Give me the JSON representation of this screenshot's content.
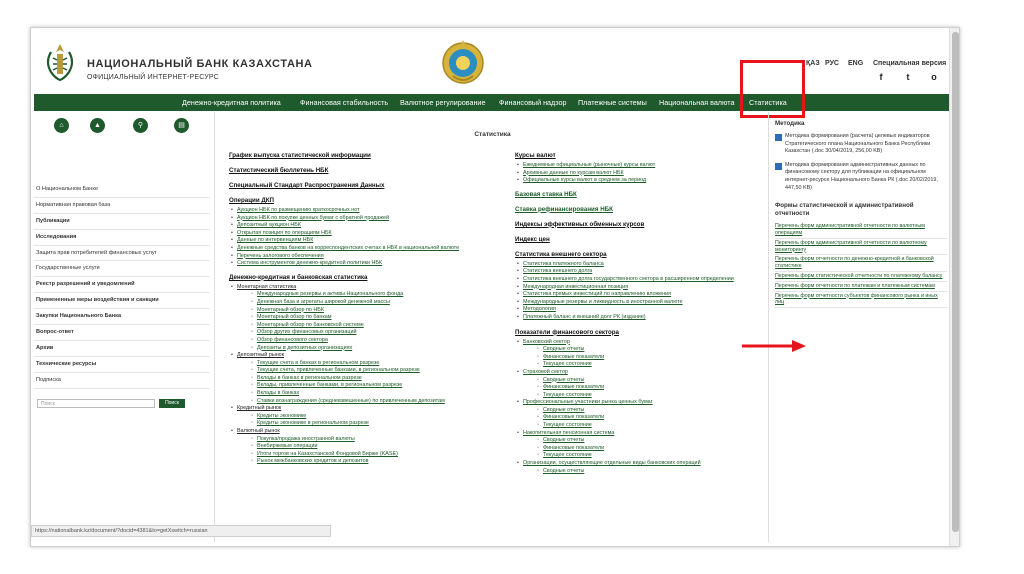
{
  "header": {
    "bank_name": "НАЦИОНАЛЬНЫЙ БАНК КАЗАХСТАНА",
    "bank_sub": "ОФИЦИАЛЬНЫЙ ИНТЕРНЕТ-РЕСУРС",
    "lang_kz": "ҚАЗ",
    "lang_ru": "РУС",
    "lang_en": "ENG",
    "special_version": "Специальная версия",
    "social": {
      "facebook": "f",
      "twitter": "t",
      "instagram": "o"
    }
  },
  "nav": {
    "items": [
      "Денежно-кредитная политика",
      "Финансовая стабильность",
      "Валютное регулирование",
      "Финансовый надзор",
      "Платежные системы",
      "Национальная валюта",
      "Статистика"
    ]
  },
  "sidebar": {
    "icons": [
      "home-icon",
      "user-icon",
      "search-icon",
      "printer-icon"
    ],
    "items": [
      "О Национальном Банке",
      "Нормативная правовая база",
      "Публикации",
      "Исследования",
      "Защита прав потребителей финансовых услуг",
      "Государственные услуги",
      "Реестр разрешений и уведомлений",
      "Примененные меры воздействия и санкции",
      "Закупки Национального Банка",
      "Вопрос-ответ",
      "Архив",
      "Технические ресурсы",
      "Подписка"
    ],
    "search_placeholder": "Поиск",
    "search_button": "Поиск"
  },
  "main": {
    "title": "Статистика",
    "left": {
      "s1": "График выпуска статистической информации",
      "s2": "Статистический бюллетень НБК",
      "s3": "Специальный Стандарт Распространения Данных",
      "s4": "Операции ДКП",
      "ops": [
        "Аукцион НБК по размещению краткосрочных нот",
        "Аукцион НБК по покупке ценных бумаг с обратной продажей",
        "Депозитный аукцион НБК",
        "Открытая позиция по операциям НБК",
        "Данные по интервенциям НБК",
        "Денежные средства банков на корреспондентских счетах в НБК в национальной валюте",
        "Перечень залогового обеспечения",
        "Система инструментов денежно-кредитной политики НБК"
      ],
      "s5": "Денежно-кредитная и банковская статистика",
      "dk": [
        {
          "t": "Монетарная статистика",
          "l": 1
        },
        {
          "t": "Международные резервы и активы Национального фонда",
          "l": 2
        },
        {
          "t": "Денежная база и агрегаты широкой денежной массы",
          "l": 2
        },
        {
          "t": "Монетарный обзор по НБК",
          "l": 2
        },
        {
          "t": "Монетарный обзор по банкам",
          "l": 2
        },
        {
          "t": "Монетарный обзор по банковской системе",
          "l": 2
        },
        {
          "t": "Обзор других финансовых организаций",
          "l": 2
        },
        {
          "t": "Обзор финансового сектора",
          "l": 2
        },
        {
          "t": "Депозиты в депозитных организациях",
          "l": 2
        },
        {
          "t": "Депозитный рынок",
          "l": 1
        },
        {
          "t": "Текущие счета в банках в региональном разрезе",
          "l": 2
        },
        {
          "t": "Текущие счета, привлеченные банками, в региональном разрезе",
          "l": 2
        },
        {
          "t": "Вклады в банках в региональном разрезе",
          "l": 2
        },
        {
          "t": "Вклады, привлеченные банками, в региональном разрезе",
          "l": 2
        },
        {
          "t": "Вклады в банках",
          "l": 2
        },
        {
          "t": "Ставки вознаграждения (средневзвешенные) по привлеченным депозитам",
          "l": 2
        },
        {
          "t": "Кредитный рынок",
          "l": 1
        },
        {
          "t": "Кредиты экономике",
          "l": 2
        },
        {
          "t": "Кредиты экономике в региональном разрезе",
          "l": 2
        },
        {
          "t": "Валютный рынок",
          "l": 1
        },
        {
          "t": "Покупка/продажа иностранной валюты",
          "l": 2
        },
        {
          "t": "Внебиржевые операции",
          "l": 2
        },
        {
          "t": "Итоги торгов на Казахстанской Фондовой Бирже (KASE)",
          "l": 2
        },
        {
          "t": "Рынок межбанковских кредитов и депозитов",
          "l": 2
        }
      ]
    },
    "right": {
      "s1": "Курсы валют",
      "fx": [
        "Ежедневные официальные (рыночные) курсы валют",
        "Архивные данные по курсам валют НБК",
        "Официальные курсы валют в среднем за период"
      ],
      "s2": "Базовая ставка НБК",
      "s3": "Ставка рефинансирования НБК",
      "s4": "Индексы эффективных обменных курсов",
      "s5": "Индекс цен",
      "s6": "Статистика внешнего сектора",
      "ext": [
        "Статистика платежного баланса",
        "Статистика внешнего долга",
        "Статистика внешнего долга государственного сектора в расширенном определении",
        "Международная инвестиционная позиция",
        "Статистика прямых инвестиций по направлению вложения",
        "Международные резервы и ликвидность в иностранной валюте",
        "Методология",
        "Платежный баланс и внешний долг РК (издание)"
      ],
      "s7": "Показатели финансового сектора",
      "fin": [
        {
          "t": "Банковский сектор",
          "l": 1
        },
        {
          "t": "Сводные отчеты",
          "l": 2
        },
        {
          "t": "Финансовые показатели",
          "l": 2
        },
        {
          "t": "Текущее состояние",
          "l": 2
        },
        {
          "t": "Страховой сектор",
          "l": 1
        },
        {
          "t": "Сводные отчеты",
          "l": 2
        },
        {
          "t": "Финансовые показатели",
          "l": 2
        },
        {
          "t": "Текущее состояние",
          "l": 2
        },
        {
          "t": "Профессиональные участники рынка ценных бумаг",
          "l": 1
        },
        {
          "t": "Сводные отчеты",
          "l": 2
        },
        {
          "t": "Финансовые показатели",
          "l": 2
        },
        {
          "t": "Текущее состояние",
          "l": 2
        },
        {
          "t": "Накопительная пенсионная система",
          "l": 1
        },
        {
          "t": "Сводные отчеты",
          "l": 2
        },
        {
          "t": "Финансовые показатели",
          "l": 2
        },
        {
          "t": "Текущее состояние",
          "l": 2
        },
        {
          "t": "Организации, осуществляющие отдельные виды банковских операций",
          "l": 1
        },
        {
          "t": "Сводные отчеты",
          "l": 2
        }
      ]
    }
  },
  "right_panel": {
    "title": "Методика",
    "doc1": "Методика формирования (расчета) целевых индикаторов Стратегического плана Национального Банка Республики Казахстан (.doc 30/04/2019, 256,00 KB)",
    "doc2": "Методика формирования административных данных по финансовому сектору для публикации на официальном интернет-ресурсе Национального Банка РК (.doc 20/02/2019, 447,50 KB)",
    "forms_title": "Формы статистической и административной отчетности",
    "links": [
      "Перечень форм административной отчетности по валютным операциям",
      "Перечень форм административной отчетности по валютному мониторингу",
      "Перечень форм отчетности по денежно-кредитной и банковской статистике",
      "Перечень форм статистической отчетности по платежному балансу",
      "Перечень форм отчетности по платежам и платежным системам",
      "Перечень форм отчетности субъектов финансового рынка и иных лиц"
    ]
  },
  "status_url": "https://nationalbank.kz/document/?docid=4381&to=getXswitch=russian",
  "colors": {
    "brand": "#1f5a2d",
    "highlight": "#e8141b"
  }
}
